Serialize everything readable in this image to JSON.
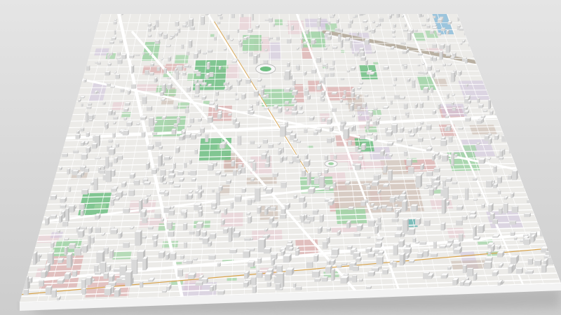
{
  "scene": {
    "subject": "",
    "palette": {
      "backdrop_top": "#e5e5e5",
      "backdrop_bottom": "#cdcdcd",
      "ground": "#ecebe8",
      "road": "#ffffff",
      "building_top": "#fbfbfb",
      "building_side_left": "#d9d9d9",
      "building_side_right": "#bfbfbf",
      "park": "#9fd4a4",
      "park_dark": "#6fbf82",
      "landuse_pink": "#e9c9cf",
      "landuse_purple": "#cfc3dd",
      "landuse_brown": "#cbb8ab",
      "landuse_red": "#d99a9a",
      "landuse_teal": "#6fb7b4",
      "water": "#93c1dc",
      "rail": "#b9b0a2",
      "road_accent": "#d7a24a",
      "slab_front": "#f3f3f3",
      "slab_right": "#c9c9c9",
      "shadow": "#9a9a9a"
    },
    "icons": [
      "stadium-icon"
    ]
  }
}
